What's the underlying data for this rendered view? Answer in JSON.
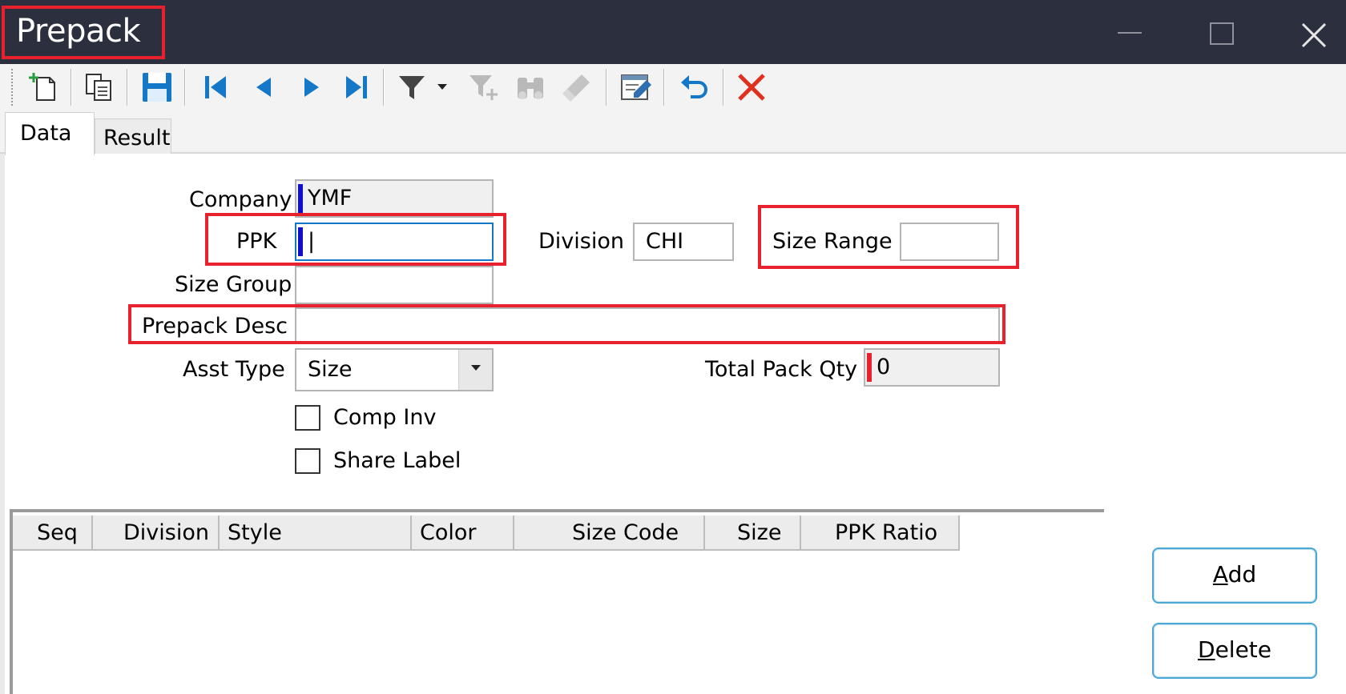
{
  "window": {
    "title": "Prepack",
    "minimize_icon": "minimize-icon",
    "maximize_icon": "maximize-icon",
    "close_icon": "close-icon"
  },
  "toolbar": {
    "icons": [
      "new-record-icon",
      "copy-record-icon",
      "save-icon",
      "first-record-icon",
      "previous-record-icon",
      "next-record-icon",
      "last-record-icon",
      "filter-icon",
      "filter-dropdown-icon",
      "add-filter-icon",
      "binoculars-find-icon",
      "clear-icon",
      "edit-form-icon",
      "undo-icon",
      "delete-icon"
    ]
  },
  "tabs": {
    "data": "Data",
    "result": "Result"
  },
  "form": {
    "company_label": "Company",
    "company_value": "YMF",
    "ppk_label": "PPK",
    "ppk_value": "|",
    "division_label": "Division",
    "division_value": "CHI",
    "size_range_label": "Size Range",
    "size_range_value": "",
    "size_group_label": "Size Group",
    "size_group_value": "",
    "prepack_desc_label": "Prepack Desc",
    "prepack_desc_value": "",
    "asst_type_label": "Asst Type",
    "asst_type_value": "Size",
    "total_pack_qty_label": "Total Pack Qty",
    "total_pack_qty_value": "0",
    "comp_inv_label": "Comp Inv",
    "comp_inv_checked": false,
    "share_label_label": "Share Label",
    "share_label_checked": false
  },
  "grid": {
    "columns": [
      "Seq",
      "Division",
      "Style",
      "Color",
      "Size Code",
      "Size",
      "PPK Ratio"
    ],
    "rows": []
  },
  "buttons": {
    "add_mnemonic": "A",
    "add_rest": "dd",
    "delete_mnemonic": "D",
    "delete_rest": "elete"
  },
  "colors": {
    "titlebar": "#2b2f3e",
    "highlight": "#e8222c",
    "required_marker": "#1010c8",
    "total_marker": "#e8222c",
    "button_border": "#4aa7d6"
  }
}
